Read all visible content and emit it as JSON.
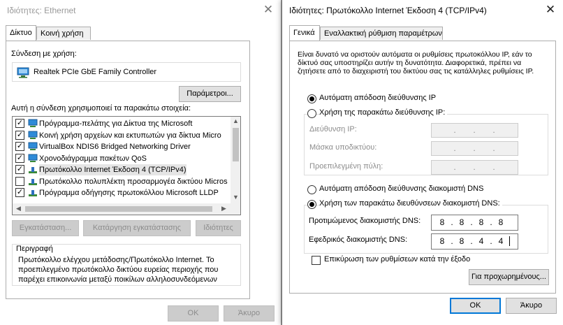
{
  "left_window": {
    "title": "Ιδιότητες: Ethernet",
    "tabs": [
      "Δίκτυο",
      "Κοινή χρήση"
    ],
    "connect_using_label": "Σύνδεση με χρήση:",
    "adapter_name": "Realtek PCIe GbE Family Controller",
    "configure_button": "Παράμετροι...",
    "items_label": "Αυτή η σύνδεση χρησιμοποιεί τα παρακάτω στοιχεία:",
    "items": [
      {
        "label": "Πρόγραμμα-πελάτης για Δίκτυα της Microsoft",
        "checked": true,
        "icon": "network-client-icon"
      },
      {
        "label": "Κοινή χρήση αρχείων και εκτυπωτών για δίκτυα Micro",
        "checked": true,
        "icon": "network-client-icon"
      },
      {
        "label": "VirtualBox NDIS6 Bridged Networking Driver",
        "checked": true,
        "icon": "network-client-icon"
      },
      {
        "label": "Χρονοδιάγραμμα πακέτων QoS",
        "checked": true,
        "icon": "network-client-icon"
      },
      {
        "label": "Πρωτόκολλο Internet Έκδοση 4 (TCP/IPv4)",
        "checked": true,
        "icon": "protocol-icon"
      },
      {
        "label": "Πρωτόκολλο πολυπλέκτη προσαρμογέα δικτύου Micros",
        "checked": false,
        "icon": "protocol-icon"
      },
      {
        "label": "Πρόγραμμα οδήγησης πρωτοκόλλου Microsoft LLDP",
        "checked": true,
        "icon": "protocol-icon"
      }
    ],
    "install_button": "Εγκατάσταση...",
    "uninstall_button": "Κατάργηση εγκατάστασης",
    "properties_button": "Ιδιότητες",
    "description_title": "Περιγραφή",
    "description_text": "Πρωτόκολλο ελέγχου μετάδοσης/Πρωτόκολλο Internet. Το προεπιλεγμένο πρωτόκολλο δικτύου ευρείας περιοχής που παρέχει επικοινωνία μεταξύ ποικίλων αλληλοσυνδεόμενων δικτύων.",
    "ok_button": "ΟΚ",
    "cancel_button": "Άκυρο"
  },
  "right_window": {
    "title": "Ιδιότητες: Πρωτόκολλο Internet Έκδοση 4 (TCP/IPv4)",
    "tabs": [
      "Γενικά",
      "Εναλλακτική ρύθμιση παραμέτρων"
    ],
    "intro_text": "Είναι δυνατό να οριστούν αυτόματα οι ρυθμίσεις πρωτοκόλλου IP, εάν το δίκτυό σας υποστηρίζει αυτήν τη δυνατότητα. Διαφορετικά, πρέπει να ζητήσετε από το διαχειριστή του δικτύου σας τις κατάλληλες ρυθμίσεις IP.",
    "auto_ip_label": "Αυτόματη απόδοση διεύθυνσης IP",
    "manual_ip_label": "Χρήση της παρακάτω διεύθυνσης IP:",
    "ip_address_label": "Διεύθυνση IP:",
    "subnet_label": "Μάσκα υποδικτύου:",
    "gateway_label": "Προεπιλεγμένη πύλη:",
    "auto_dns_label": "Αυτόματη απόδοση διεύθυνσης διακομιστή DNS",
    "manual_dns_label": "Χρήση των παρακάτω διευθύνσεων διακομιστή DNS:",
    "preferred_dns_label": "Προτιμώμενος διακομιστής DNS:",
    "alternate_dns_label": "Εφεδρικός διακομιστής DNS:",
    "preferred_dns": [
      "8",
      "8",
      "8",
      "8"
    ],
    "alternate_dns": [
      "8",
      "8",
      "4",
      "4"
    ],
    "validate_label": "Επικύρωση των ρυθμίσεων κατά την έξοδο",
    "advanced_button": "Για προχωρημένους...",
    "ok_button": "OK",
    "cancel_button": "Άκυρο",
    "selected_ip_mode": "auto",
    "selected_dns_mode": "manual"
  }
}
